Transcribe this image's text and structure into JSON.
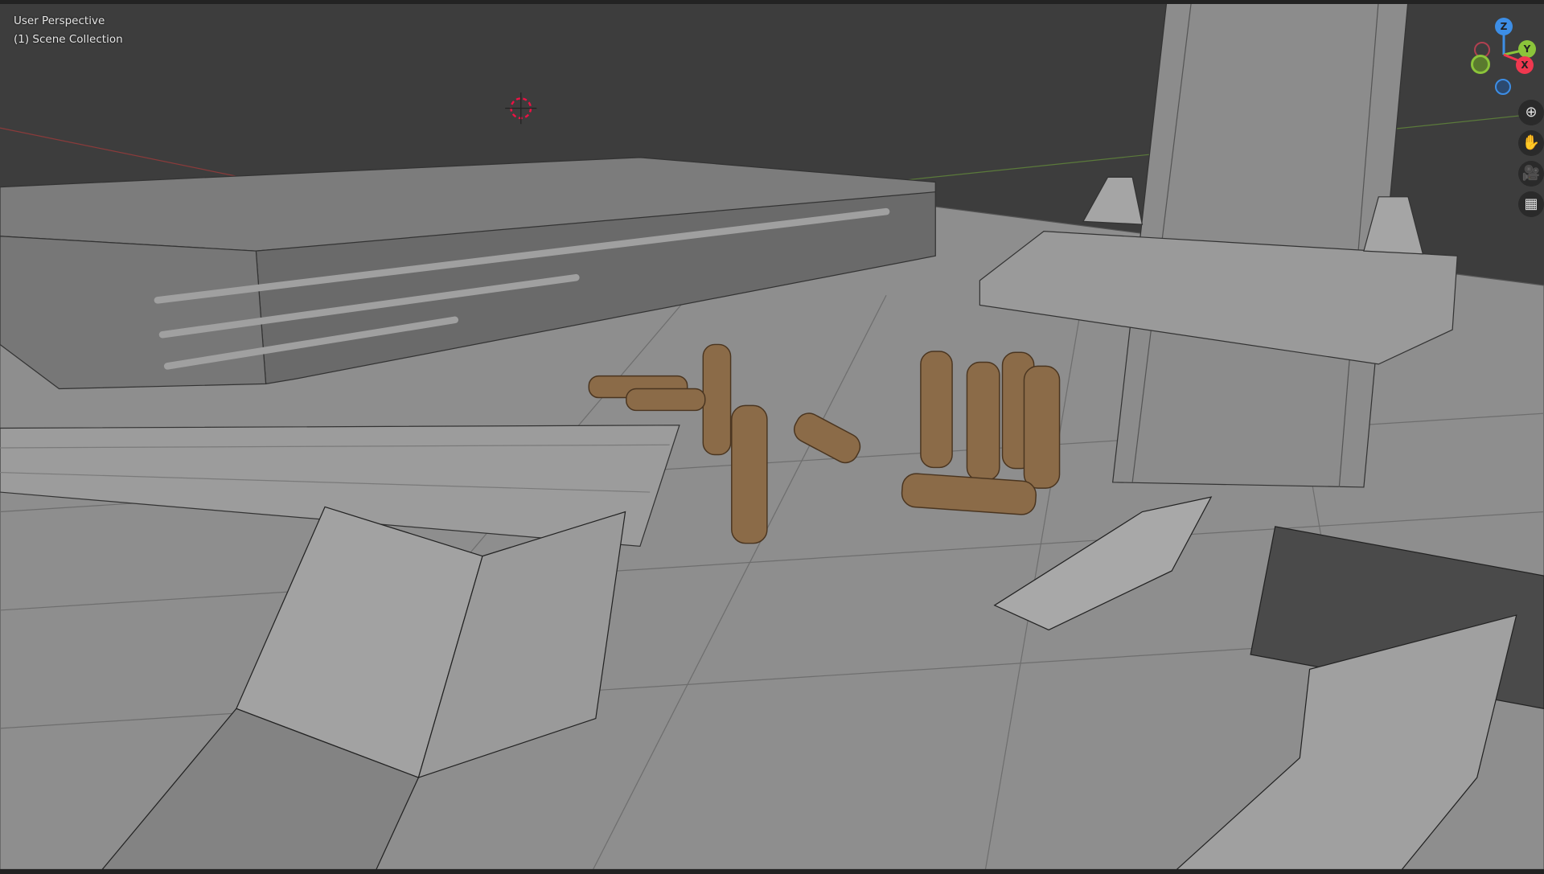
{
  "viewport": {
    "view_name": "User Perspective",
    "collection": "(1) Scene Collection"
  },
  "gizmo": {
    "axes": [
      {
        "label": "Z",
        "color": "#3d8ee6"
      },
      {
        "label": "Y",
        "color": "#8bc43a"
      },
      {
        "label": "X",
        "color": "#f0384f"
      }
    ]
  },
  "nav_tools": [
    {
      "name": "zoom",
      "glyph": "⊕"
    },
    {
      "name": "pan",
      "glyph": "✋"
    },
    {
      "name": "camera",
      "glyph": "🎥"
    },
    {
      "name": "grid-view",
      "glyph": "▦"
    }
  ],
  "colors": {
    "floor": "#8e8e8e",
    "brass": "#8b6b48",
    "background": "#3d3d3d"
  }
}
